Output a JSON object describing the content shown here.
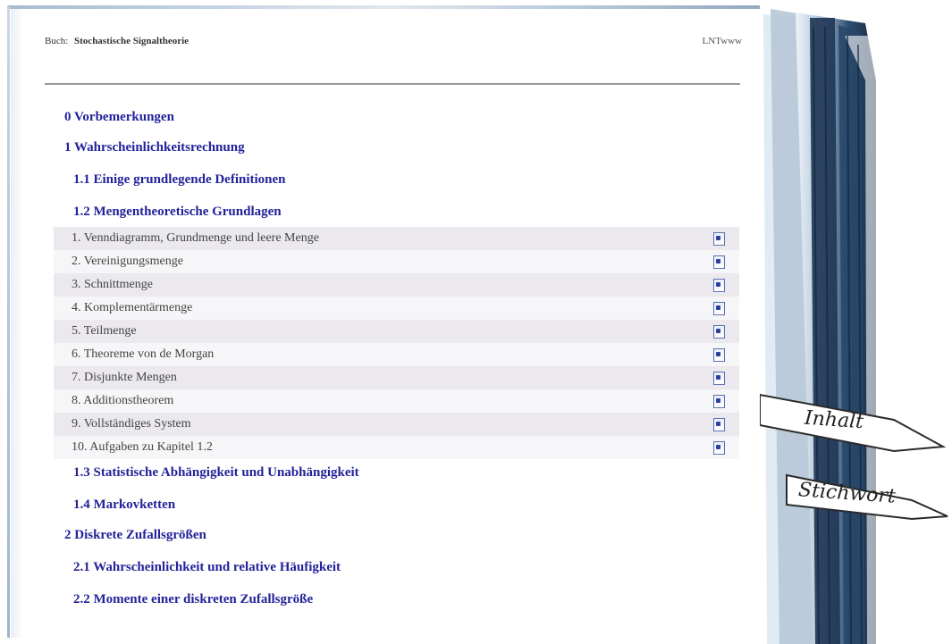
{
  "header": {
    "book_prefix": "Buch:",
    "book_title": "Stochastische Signaltheorie",
    "site": "LNTwww"
  },
  "toc": {
    "ch0": "0 Vorbemerkungen",
    "ch1": "1 Wahrscheinlichkeitsrechnung",
    "s1_1": "1.1 Einige grundlegende Definitionen",
    "s1_2": "1.2 Mengentheoretische Grundlagen",
    "items": [
      "1. Venndiagramm, Grundmenge und leere Menge",
      "2. Vereinigungsmenge",
      "3. Schnittmenge",
      "4. Komplementärmenge",
      "5. Teilmenge",
      "6. Theoreme von de Morgan",
      "7. Disjunkte Mengen",
      "8. Additionstheorem",
      "9. Vollständiges System",
      "10. Aufgaben zu Kapitel 1.2"
    ],
    "s1_3": "1.3 Statistische Abhängigkeit und Unabhängigkeit",
    "s1_4": "1.4 Markovketten",
    "ch2": "2 Diskrete Zufallsgrößen",
    "s2_1": "2.1 Wahrscheinlichkeit und relative Häufigkeit",
    "s2_2": "2.2 Momente einer diskreten Zufallsgröße"
  },
  "banners": {
    "inhalt": "Inhalt",
    "stichwort": "Stichwort"
  },
  "colors": {
    "link": "#22229a",
    "row_odd": "#ece9ee",
    "row_even": "#f6f5f7",
    "spine": "#2f4f73"
  },
  "icons": {
    "page": "document-icon"
  }
}
